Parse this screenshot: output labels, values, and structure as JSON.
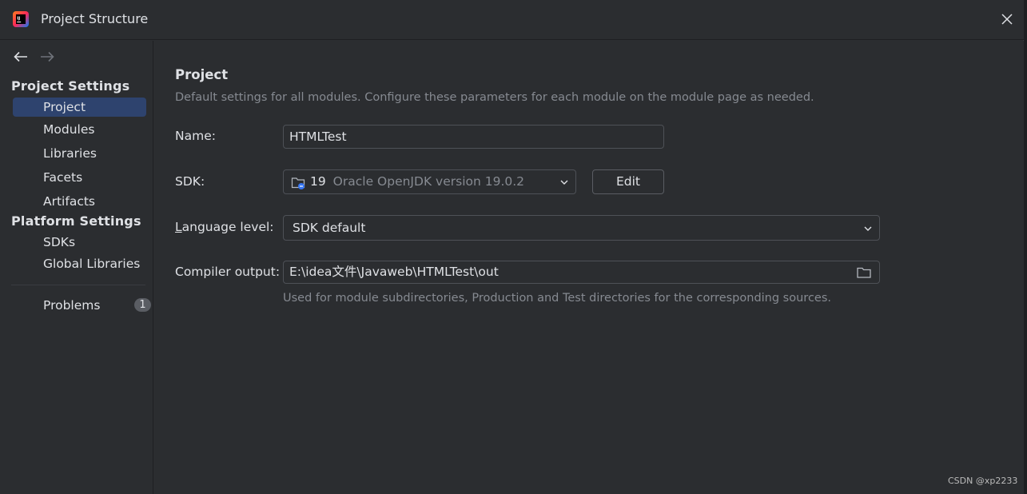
{
  "window": {
    "title": "Project Structure",
    "app_icon": "intellij-idea-icon"
  },
  "sidebar": {
    "project_settings_header": "Project Settings",
    "project_items": [
      {
        "label": "Project",
        "selected": true
      },
      {
        "label": "Modules"
      },
      {
        "label": "Libraries"
      },
      {
        "label": "Facets"
      },
      {
        "label": "Artifacts"
      }
    ],
    "platform_settings_header": "Platform Settings",
    "platform_items": [
      {
        "label": "SDKs"
      },
      {
        "label": "Global Libraries"
      }
    ],
    "problems": {
      "label": "Problems",
      "count": "1"
    }
  },
  "content": {
    "heading": "Project",
    "description": "Default settings for all modules. Configure these parameters for each module on the module page as needed.",
    "name_label": "Name:",
    "name_value": "HTMLTest",
    "sdk_label": "SDK:",
    "sdk_version": "19",
    "sdk_name": "Oracle OpenJDK version 19.0.2",
    "edit_label": "Edit",
    "language_label": "Language level:",
    "language_value": "SDK default",
    "compiler_label": "Compiler output:",
    "compiler_value": "E:\\idea文件\\Javaweb\\HTMLTest\\out",
    "compiler_hint": "Used for module subdirectories, Production and Test directories for the corresponding sources."
  },
  "watermark": "CSDN @xp2233",
  "colors": {
    "background": "#2b2d30",
    "selection": "#2e436e",
    "muted_text": "#868a91",
    "text": "#dfe1e5",
    "border": "#4e5157"
  }
}
